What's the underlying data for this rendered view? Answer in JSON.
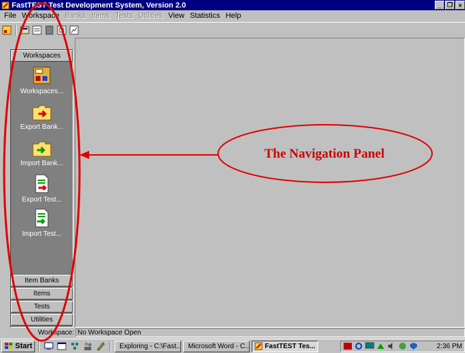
{
  "window": {
    "title": "FastTEST Test Development System, Version 2.0",
    "controls": [
      "_",
      "❐",
      "×"
    ]
  },
  "menu": [
    {
      "label": "File",
      "enabled": true
    },
    {
      "label": "Workspace",
      "enabled": true
    },
    {
      "label": "Banks",
      "enabled": false
    },
    {
      "label": "Items",
      "enabled": false
    },
    {
      "label": "Tests",
      "enabled": false
    },
    {
      "label": "Utilities",
      "enabled": false
    },
    {
      "label": "View",
      "enabled": true
    },
    {
      "label": "Statistics",
      "enabled": true
    },
    {
      "label": "Help",
      "enabled": true
    }
  ],
  "nav": {
    "header": "Workspaces",
    "items": [
      {
        "label": "Workspaces...",
        "icon": "workspace-icon"
      },
      {
        "label": "Export Bank...",
        "icon": "export-bank-icon"
      },
      {
        "label": "Import Bank...",
        "icon": "import-bank-icon"
      },
      {
        "label": "Export Test...",
        "icon": "export-test-icon"
      },
      {
        "label": "Import Test...",
        "icon": "import-test-icon"
      }
    ],
    "tabs": [
      "Item Banks",
      "Items",
      "Tests",
      "Utilities"
    ]
  },
  "status": {
    "label": "Workspace:",
    "value": "No Workspace Open"
  },
  "taskbar": {
    "start": "Start",
    "tasks": [
      {
        "label": "Exploring - C:\\Fast...",
        "active": false
      },
      {
        "label": "Microsoft Word - C...",
        "active": false
      },
      {
        "label": "FastTEST Tes...",
        "active": true
      }
    ],
    "clock": "2:36 PM"
  },
  "annotation": {
    "callout": "The Navigation Panel",
    "color": "#e00000"
  },
  "colors": {
    "titlebar": "#000080",
    "face": "#c0c0c0",
    "panel": "#808080"
  }
}
